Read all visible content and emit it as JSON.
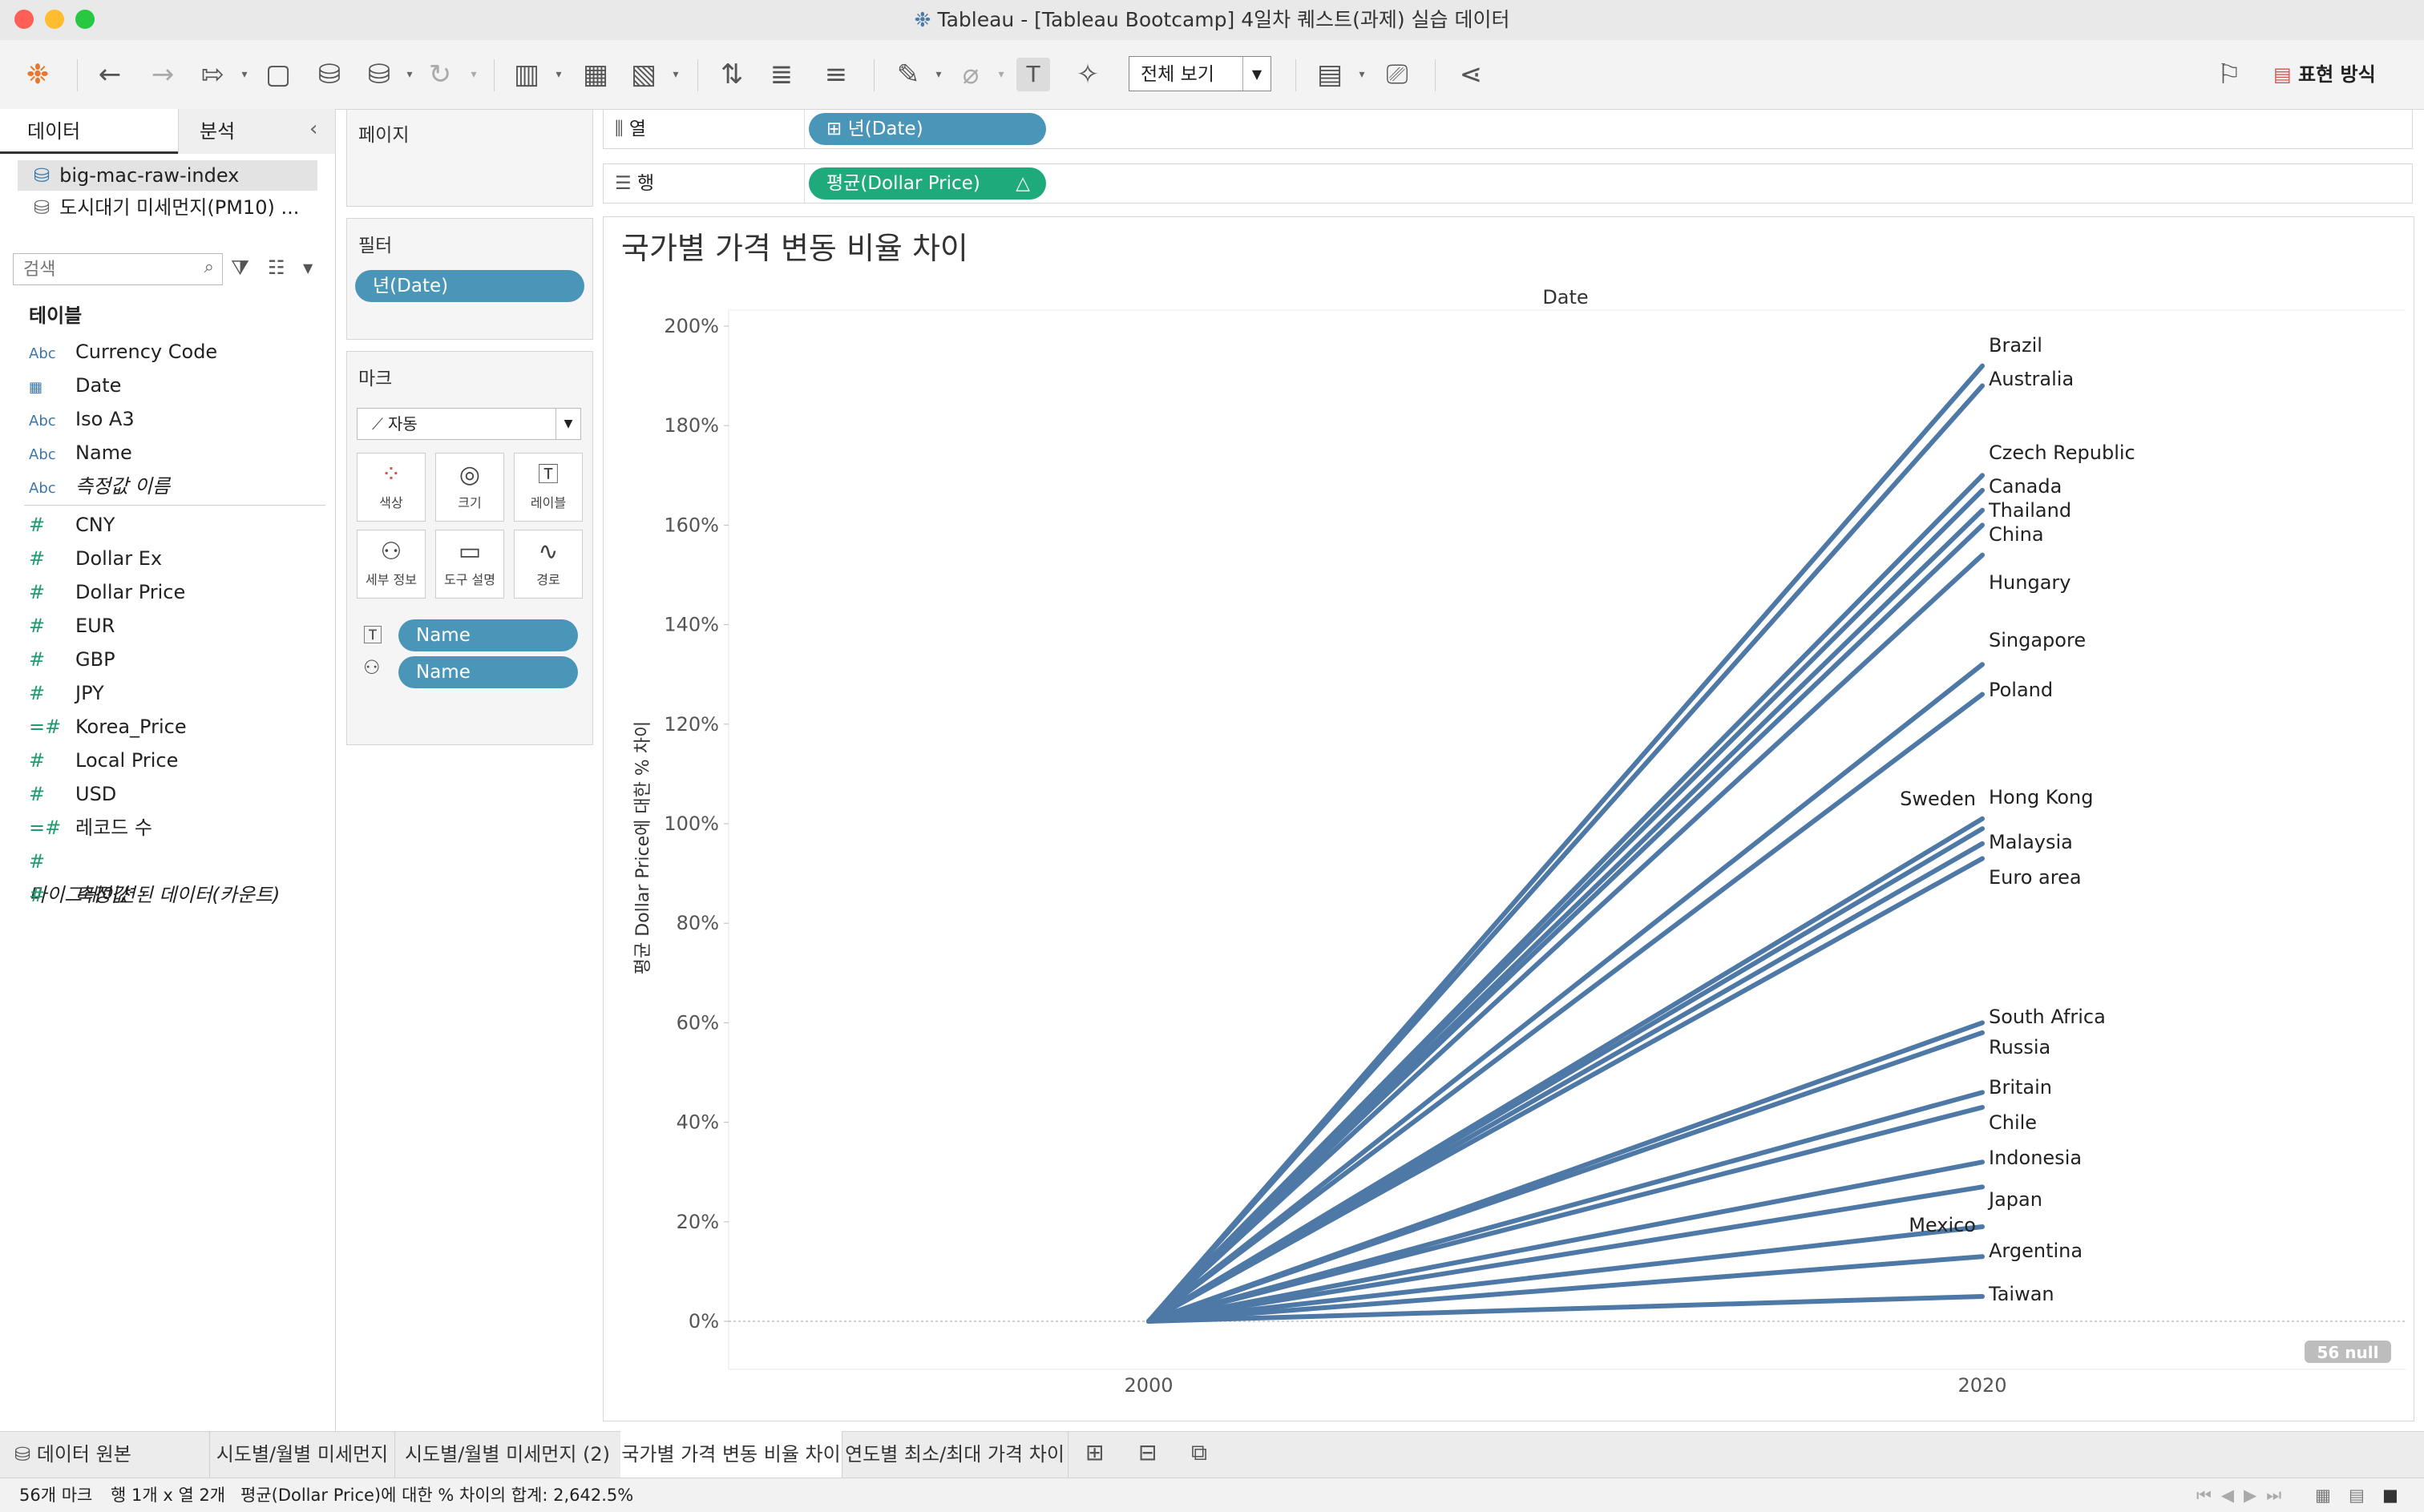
{
  "window": {
    "title": "Tableau - [Tableau Bootcamp] 4일차 퀘스트(과제) 실습 데이터"
  },
  "toolbar": {
    "fit_value": "전체 보기",
    "show_me_label": "표현 방식"
  },
  "data_pane": {
    "tab_data": "데이터",
    "tab_analytics": "분석",
    "collapse_icon": "chevron-left-icon",
    "data_sources": [
      "big-mac-raw-index",
      "도시대기 미세먼지(PM10) ..."
    ],
    "search_placeholder": "검색",
    "tables_heading": "테이블",
    "fields": [
      {
        "type": "Abc",
        "name": "Currency Code",
        "italic": false
      },
      {
        "type": "date",
        "name": "Date",
        "italic": false
      },
      {
        "type": "Abc",
        "name": "Iso A3",
        "italic": false
      },
      {
        "type": "Abc",
        "name": "Name",
        "italic": false
      },
      {
        "type": "Abc",
        "name": "측정값 이름",
        "italic": true
      },
      {
        "type": "#",
        "name": "CNY",
        "italic": false
      },
      {
        "type": "#",
        "name": "Dollar Ex",
        "italic": false
      },
      {
        "type": "#",
        "name": "Dollar Price",
        "italic": false
      },
      {
        "type": "#",
        "name": "EUR",
        "italic": false
      },
      {
        "type": "#",
        "name": "GBP",
        "italic": false
      },
      {
        "type": "#",
        "name": "JPY",
        "italic": false
      },
      {
        "type": "=#",
        "name": "Korea_Price",
        "italic": false
      },
      {
        "type": "#",
        "name": "Local Price",
        "italic": false
      },
      {
        "type": "#",
        "name": "USD",
        "italic": false
      },
      {
        "type": "=#",
        "name": "레코드 수",
        "italic": false
      },
      {
        "type": "#",
        "name": "마이그레이션된 데이터(카운트)",
        "italic": true
      },
      {
        "type": "#",
        "name": "측정값",
        "italic": true
      }
    ]
  },
  "shelves": {
    "pages_label": "페이지",
    "filters_label": "필터",
    "filter_pill": "년(Date)",
    "columns_label": "열",
    "columns_pill": "⊞ 년(Date)",
    "rows_label": "행",
    "rows_pill": "평균(Dollar Price)",
    "rows_pill_delta": "△"
  },
  "marks": {
    "label": "마크",
    "type": "자동",
    "buttons": [
      "색상",
      "크기",
      "레이블",
      "세부 정보",
      "도구 설명",
      "경로"
    ],
    "pill_label": "Name",
    "pill_detail": "Name"
  },
  "sheet_title": "국가별 가격 변동 비율 차이",
  "null_badge": "56 null",
  "chart_data": {
    "type": "line",
    "title": "국가별 가격 변동 비율 차이",
    "column_header": "Date",
    "ylabel": "평균 Dollar Price에 대한 % 차이",
    "x": [
      "2000",
      "2020"
    ],
    "y_ticks": [
      "0%",
      "20%",
      "40%",
      "60%",
      "80%",
      "100%",
      "120%",
      "140%",
      "160%",
      "180%",
      "200%"
    ],
    "ylim": [
      -10,
      200
    ],
    "line_color": "#4e79a7",
    "series": [
      {
        "name": "Brazil",
        "values": [
          0,
          192
        ]
      },
      {
        "name": "Australia",
        "values": [
          0,
          188
        ]
      },
      {
        "name": "Czech Republic",
        "values": [
          0,
          170
        ]
      },
      {
        "name": "Canada",
        "values": [
          0,
          167
        ]
      },
      {
        "name": "Thailand",
        "values": [
          0,
          163
        ]
      },
      {
        "name": "China",
        "values": [
          0,
          160
        ]
      },
      {
        "name": "Hungary",
        "values": [
          0,
          154
        ]
      },
      {
        "name": "Singapore",
        "values": [
          0,
          132
        ]
      },
      {
        "name": "Poland",
        "values": [
          0,
          126
        ]
      },
      {
        "name": "Sweden",
        "values": [
          0,
          101
        ]
      },
      {
        "name": "Hong Kong",
        "values": [
          0,
          99
        ]
      },
      {
        "name": "Malaysia",
        "values": [
          0,
          96
        ]
      },
      {
        "name": "Euro area",
        "values": [
          0,
          93
        ]
      },
      {
        "name": "South Africa",
        "values": [
          0,
          60
        ]
      },
      {
        "name": "Russia",
        "values": [
          0,
          58
        ]
      },
      {
        "name": "Britain",
        "values": [
          0,
          46
        ]
      },
      {
        "name": "Chile",
        "values": [
          0,
          43
        ]
      },
      {
        "name": "Indonesia",
        "values": [
          0,
          32
        ]
      },
      {
        "name": "Japan",
        "values": [
          0,
          27
        ]
      },
      {
        "name": "Mexico",
        "values": [
          0,
          19
        ]
      },
      {
        "name": "Argentina",
        "values": [
          0,
          13
        ]
      },
      {
        "name": "Taiwan",
        "values": [
          0,
          5
        ]
      }
    ]
  },
  "bottom_tabs": {
    "data_source": "데이터 원본",
    "sheets": [
      "시도별/월별 미세먼지",
      "시도별/월별 미세먼지 (2)",
      "국가별 가격 변동 비율 차이",
      "연도별 최소/최대 가격 차이"
    ],
    "active_index": 2
  },
  "status": {
    "marks": "56개 마크",
    "rows_cols": "행 1개 x 열 2개",
    "sum": "평균(Dollar Price)에 대한 % 차이의 합계: 2,642.5%"
  }
}
